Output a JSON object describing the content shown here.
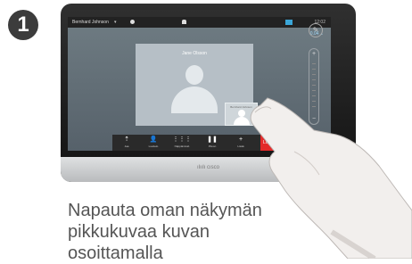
{
  "step": {
    "number": "1"
  },
  "device": {
    "statusbar": {
      "user": "Bernhard Johnson",
      "chevron": "▾",
      "time": "12:02"
    },
    "layout_link": "0.04 ⌄",
    "remote": {
      "name": "Jane Olsson"
    },
    "selfview": {
      "label": "Bernhard Johnson"
    },
    "page_dots": 3,
    "active_dot": 1,
    "call_bar": [
      {
        "icon": "share-icon",
        "glyph": "⇡",
        "label": "Jaa"
      },
      {
        "icon": "contacts-icon",
        "glyph": "👤",
        "label": "Luettelo"
      },
      {
        "icon": "keypad-icon",
        "glyph": "⋮⋮⋮",
        "label": "Näppäimistö"
      },
      {
        "icon": "pause-icon",
        "glyph": "❚❚",
        "label": "Pitoon"
      },
      {
        "icon": "add-icon",
        "glyph": "+",
        "label": "Lisää"
      }
    ],
    "end_call": "Lop",
    "mic_glyph": "✎",
    "volume": {
      "plus": "+",
      "minus": "−"
    },
    "brand": "ılıılı\ncısco"
  },
  "caption": "Napauta oman näkymän pikkukuvaa kuvan osoittamalla"
}
